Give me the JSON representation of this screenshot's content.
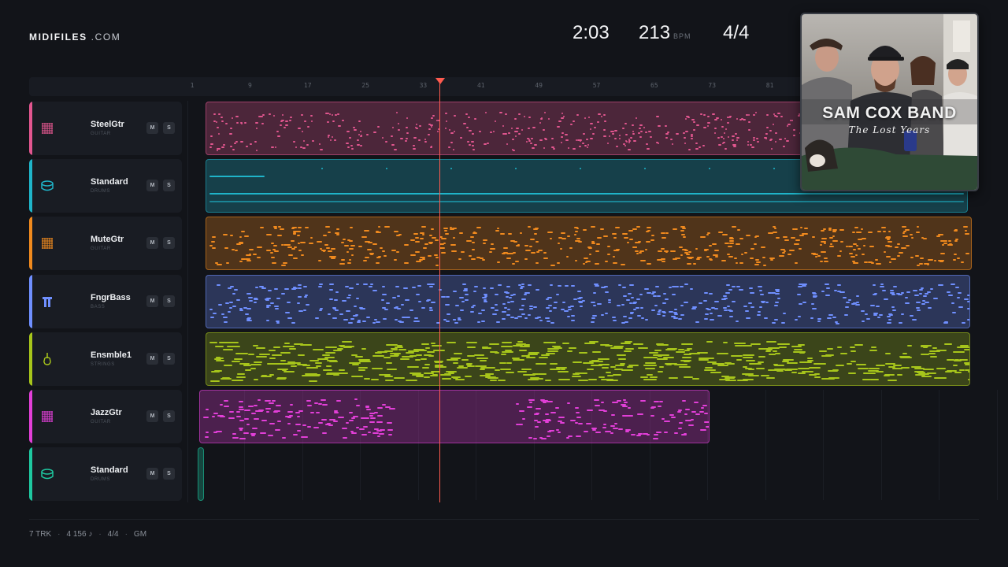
{
  "header": {
    "brand": "MIDIFILES",
    "tld": ".COM",
    "time": "2:03",
    "tempo": "213",
    "tempo_unit": "BPM",
    "time_signature": "4/4"
  },
  "ruler": {
    "bars": [
      "1",
      "9",
      "17",
      "25",
      "33",
      "41",
      "49",
      "57",
      "65",
      "73",
      "81"
    ]
  },
  "playhead": {
    "bar": 33.5
  },
  "tracks": [
    {
      "name": "SteelGtr",
      "type": "GUITAR",
      "color": "#e2568f",
      "icon": "guitar-icon",
      "mute_label": "M",
      "solo_label": "S"
    },
    {
      "name": "Standard",
      "type": "DRUMS",
      "color": "#1fb4c9",
      "icon": "drum-icon",
      "mute_label": "M",
      "solo_label": "S"
    },
    {
      "name": "MuteGtr",
      "type": "GUITAR",
      "color": "#f08a1e",
      "icon": "guitar-icon",
      "mute_label": "M",
      "solo_label": "S"
    },
    {
      "name": "FngrBass",
      "type": "BASS",
      "color": "#6f8fff",
      "icon": "bass-icon",
      "mute_label": "M",
      "solo_label": "S"
    },
    {
      "name": "Ensmble1",
      "type": "STRINGS",
      "color": "#a7c51b",
      "icon": "violin-icon",
      "mute_label": "M",
      "solo_label": "S"
    },
    {
      "name": "JazzGtr",
      "type": "GUITAR",
      "color": "#e23fd8",
      "icon": "guitar-icon",
      "mute_label": "M",
      "solo_label": "S"
    },
    {
      "name": "Standard",
      "type": "DRUMS",
      "color": "#1ec8a0",
      "icon": "drum-icon",
      "mute_label": "M",
      "solo_label": "S"
    }
  ],
  "album": {
    "title": "SAM COX BAND",
    "subtitle": "The Lost Years"
  },
  "footer": {
    "tracks": "7 TRK",
    "notes": "4 156 ♪",
    "time_signature": "4/4",
    "standard": "GM"
  }
}
